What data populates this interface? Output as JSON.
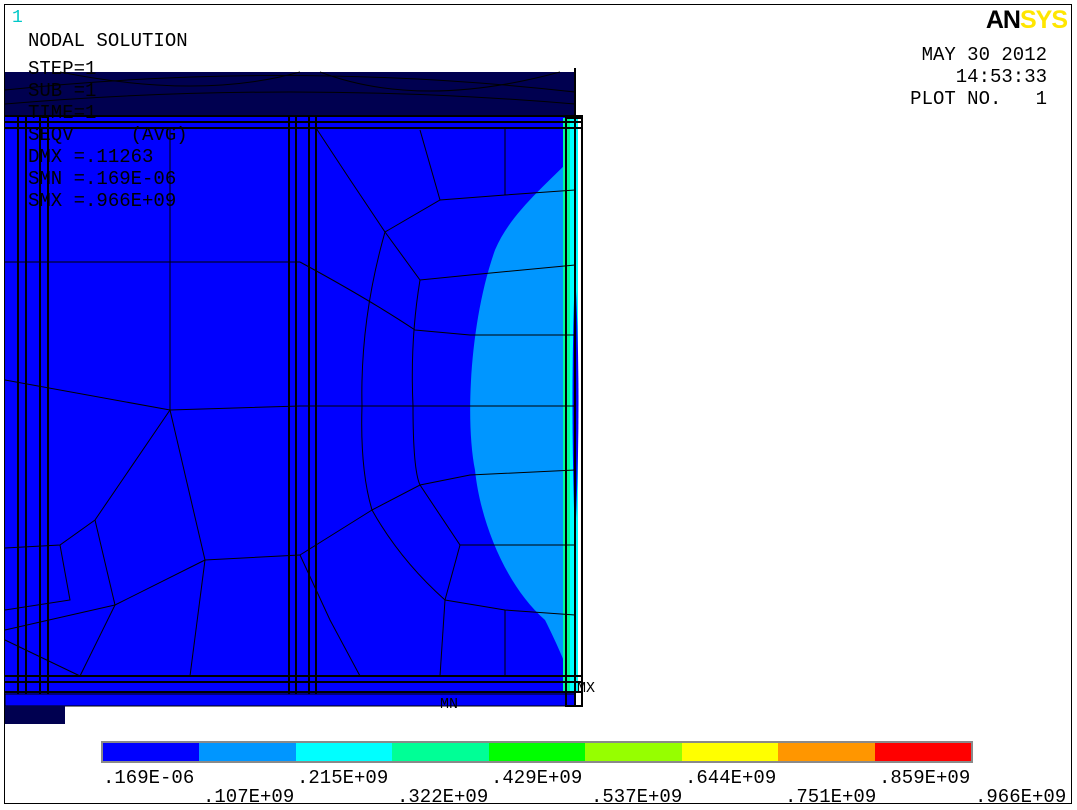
{
  "window_number": "1",
  "logo": {
    "part1": "AN",
    "part2": "SYS"
  },
  "header_left": {
    "line1": "NODAL SOLUTION",
    "line2": "STEP=1",
    "line3": "SUB =1",
    "line4": "TIME=1",
    "line5": "SEQV     (AVG)",
    "line6": "DMX =.11263",
    "line7": "SMN =.169E-06",
    "line8": "SMX =.966E+09"
  },
  "header_right": {
    "date": "MAY 30 2012",
    "time": "14:53:33",
    "plot_no": "PLOT NO.   1"
  },
  "markers": {
    "mx": "MX",
    "mn": "MN"
  },
  "legend": {
    "colors": [
      "#0000ff",
      "#0096ff",
      "#00ffff",
      "#00ff96",
      "#00ff00",
      "#96ff00",
      "#ffff00",
      "#ff9600",
      "#ff0000"
    ],
    "labels_top": [
      ".169E-06",
      ".215E+09",
      ".429E+09",
      ".644E+09",
      ".859E+09"
    ],
    "labels_bottom": [
      ".107E+09",
      ".322E+09",
      ".537E+09",
      ".751E+09",
      ".966E+09"
    ]
  },
  "contour_colors": {
    "blue": "#0000ff",
    "lightblue": "#0096ff",
    "cyan": "#00ffff",
    "green": "#00ff96",
    "darknavy": "#000050"
  }
}
